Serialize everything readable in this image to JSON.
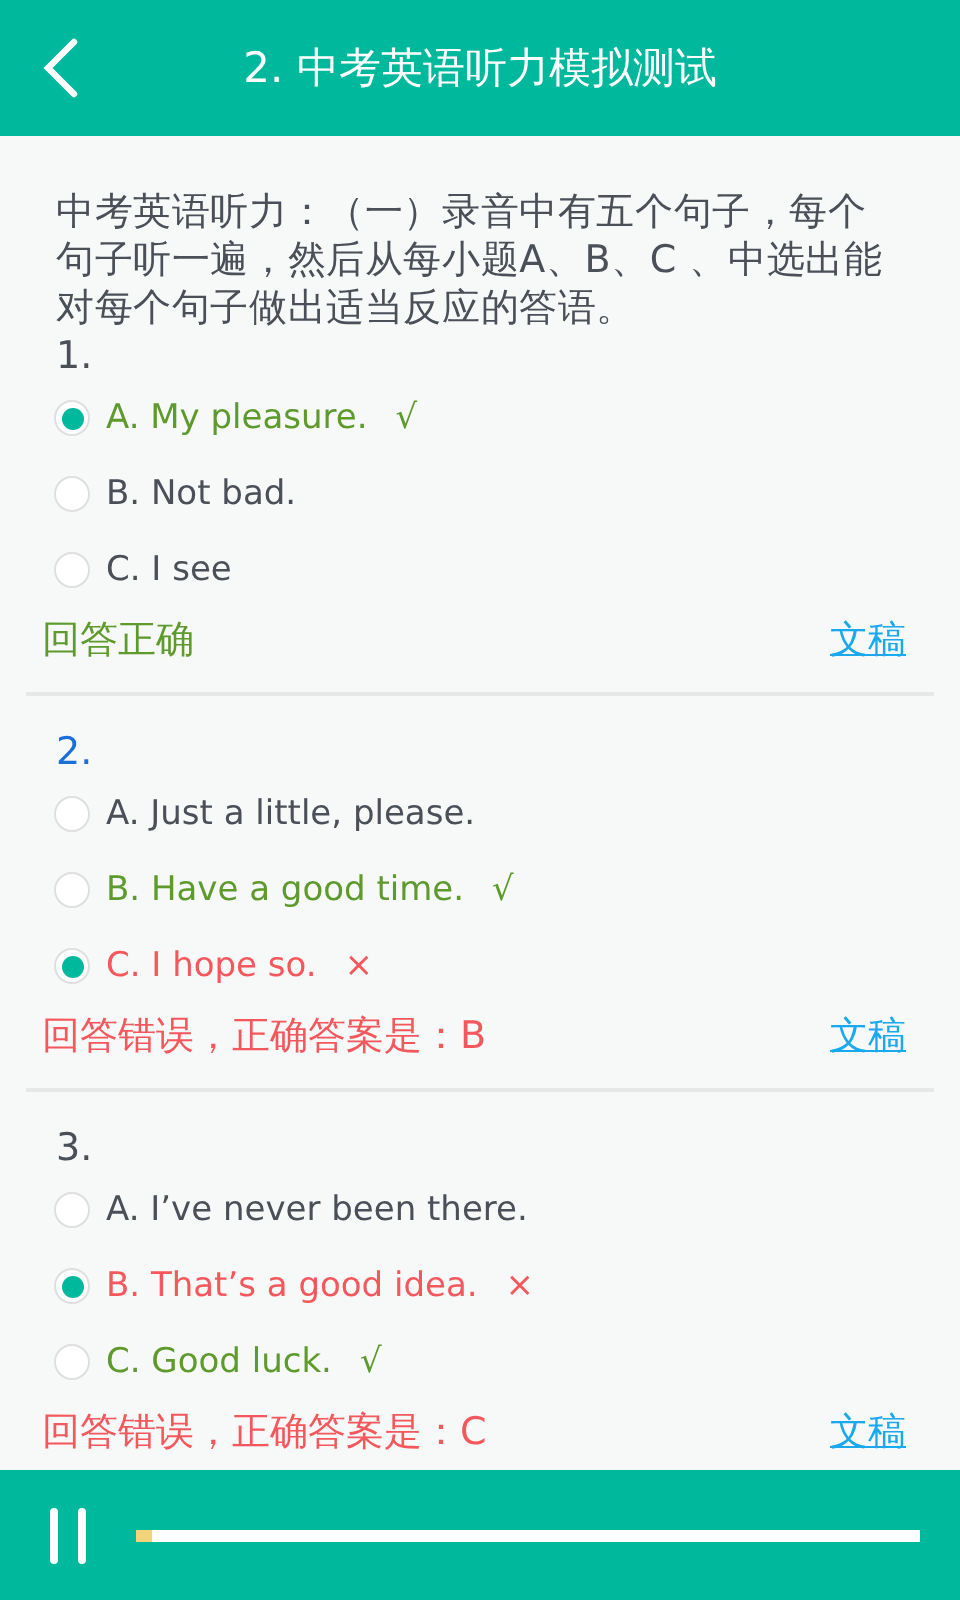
{
  "header": {
    "title": "2. 中考英语听力模拟测试"
  },
  "intro": "中考英语听力：（一）录音中有五个句子，每个句子听一遍，然后从每小题A、B、C 、中选出能对每个句子做出适当反应的答语。",
  "questions": [
    {
      "number": "1.",
      "current": false,
      "options": [
        {
          "label": "A. My pleasure.",
          "selected": true,
          "kind": "correct",
          "mark": "√"
        },
        {
          "label": "B. Not bad.",
          "selected": false,
          "kind": "neutral"
        },
        {
          "label": "C. I see",
          "selected": false,
          "kind": "neutral"
        }
      ],
      "result": {
        "text": "回答正确",
        "kind": "correct"
      },
      "link": "文稿"
    },
    {
      "number": "2.",
      "current": true,
      "options": [
        {
          "label": "A. Just a little, please.",
          "selected": false,
          "kind": "neutral"
        },
        {
          "label": "B. Have a good time.",
          "selected": false,
          "kind": "correct",
          "mark": "√"
        },
        {
          "label": "C. I hope so.",
          "selected": true,
          "kind": "wrong",
          "mark": "×"
        }
      ],
      "result": {
        "text": "回答错误，正确答案是：B",
        "kind": "wrong"
      },
      "link": "文稿"
    },
    {
      "number": "3.",
      "current": false,
      "options": [
        {
          "label": "A. I’ve never been there.",
          "selected": false,
          "kind": "neutral"
        },
        {
          "label": "B. That’s a good idea.",
          "selected": true,
          "kind": "wrong",
          "mark": "×"
        },
        {
          "label": "C. Good luck.",
          "selected": false,
          "kind": "correct",
          "mark": "√"
        }
      ],
      "result": {
        "text": "回答错误，正确答案是：C",
        "kind": "wrong"
      },
      "link": "文稿"
    }
  ],
  "player": {
    "playing": true,
    "level": 0.02
  }
}
